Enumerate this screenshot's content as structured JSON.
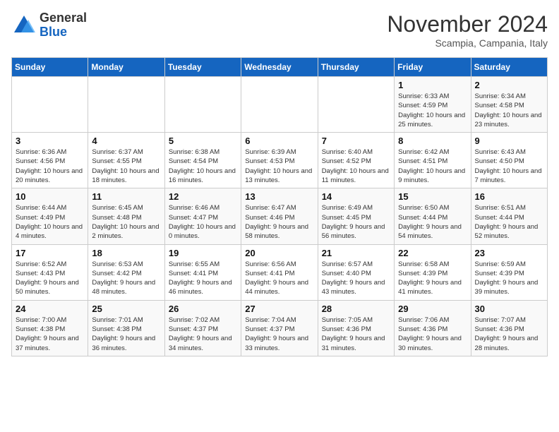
{
  "header": {
    "logo_general": "General",
    "logo_blue": "Blue",
    "month_title": "November 2024",
    "location": "Scampia, Campania, Italy"
  },
  "days_of_week": [
    "Sunday",
    "Monday",
    "Tuesday",
    "Wednesday",
    "Thursday",
    "Friday",
    "Saturday"
  ],
  "weeks": [
    [
      {
        "day": "",
        "info": ""
      },
      {
        "day": "",
        "info": ""
      },
      {
        "day": "",
        "info": ""
      },
      {
        "day": "",
        "info": ""
      },
      {
        "day": "",
        "info": ""
      },
      {
        "day": "1",
        "info": "Sunrise: 6:33 AM\nSunset: 4:59 PM\nDaylight: 10 hours and 25 minutes."
      },
      {
        "day": "2",
        "info": "Sunrise: 6:34 AM\nSunset: 4:58 PM\nDaylight: 10 hours and 23 minutes."
      }
    ],
    [
      {
        "day": "3",
        "info": "Sunrise: 6:36 AM\nSunset: 4:56 PM\nDaylight: 10 hours and 20 minutes."
      },
      {
        "day": "4",
        "info": "Sunrise: 6:37 AM\nSunset: 4:55 PM\nDaylight: 10 hours and 18 minutes."
      },
      {
        "day": "5",
        "info": "Sunrise: 6:38 AM\nSunset: 4:54 PM\nDaylight: 10 hours and 16 minutes."
      },
      {
        "day": "6",
        "info": "Sunrise: 6:39 AM\nSunset: 4:53 PM\nDaylight: 10 hours and 13 minutes."
      },
      {
        "day": "7",
        "info": "Sunrise: 6:40 AM\nSunset: 4:52 PM\nDaylight: 10 hours and 11 minutes."
      },
      {
        "day": "8",
        "info": "Sunrise: 6:42 AM\nSunset: 4:51 PM\nDaylight: 10 hours and 9 minutes."
      },
      {
        "day": "9",
        "info": "Sunrise: 6:43 AM\nSunset: 4:50 PM\nDaylight: 10 hours and 7 minutes."
      }
    ],
    [
      {
        "day": "10",
        "info": "Sunrise: 6:44 AM\nSunset: 4:49 PM\nDaylight: 10 hours and 4 minutes."
      },
      {
        "day": "11",
        "info": "Sunrise: 6:45 AM\nSunset: 4:48 PM\nDaylight: 10 hours and 2 minutes."
      },
      {
        "day": "12",
        "info": "Sunrise: 6:46 AM\nSunset: 4:47 PM\nDaylight: 10 hours and 0 minutes."
      },
      {
        "day": "13",
        "info": "Sunrise: 6:47 AM\nSunset: 4:46 PM\nDaylight: 9 hours and 58 minutes."
      },
      {
        "day": "14",
        "info": "Sunrise: 6:49 AM\nSunset: 4:45 PM\nDaylight: 9 hours and 56 minutes."
      },
      {
        "day": "15",
        "info": "Sunrise: 6:50 AM\nSunset: 4:44 PM\nDaylight: 9 hours and 54 minutes."
      },
      {
        "day": "16",
        "info": "Sunrise: 6:51 AM\nSunset: 4:44 PM\nDaylight: 9 hours and 52 minutes."
      }
    ],
    [
      {
        "day": "17",
        "info": "Sunrise: 6:52 AM\nSunset: 4:43 PM\nDaylight: 9 hours and 50 minutes."
      },
      {
        "day": "18",
        "info": "Sunrise: 6:53 AM\nSunset: 4:42 PM\nDaylight: 9 hours and 48 minutes."
      },
      {
        "day": "19",
        "info": "Sunrise: 6:55 AM\nSunset: 4:41 PM\nDaylight: 9 hours and 46 minutes."
      },
      {
        "day": "20",
        "info": "Sunrise: 6:56 AM\nSunset: 4:41 PM\nDaylight: 9 hours and 44 minutes."
      },
      {
        "day": "21",
        "info": "Sunrise: 6:57 AM\nSunset: 4:40 PM\nDaylight: 9 hours and 43 minutes."
      },
      {
        "day": "22",
        "info": "Sunrise: 6:58 AM\nSunset: 4:39 PM\nDaylight: 9 hours and 41 minutes."
      },
      {
        "day": "23",
        "info": "Sunrise: 6:59 AM\nSunset: 4:39 PM\nDaylight: 9 hours and 39 minutes."
      }
    ],
    [
      {
        "day": "24",
        "info": "Sunrise: 7:00 AM\nSunset: 4:38 PM\nDaylight: 9 hours and 37 minutes."
      },
      {
        "day": "25",
        "info": "Sunrise: 7:01 AM\nSunset: 4:38 PM\nDaylight: 9 hours and 36 minutes."
      },
      {
        "day": "26",
        "info": "Sunrise: 7:02 AM\nSunset: 4:37 PM\nDaylight: 9 hours and 34 minutes."
      },
      {
        "day": "27",
        "info": "Sunrise: 7:04 AM\nSunset: 4:37 PM\nDaylight: 9 hours and 33 minutes."
      },
      {
        "day": "28",
        "info": "Sunrise: 7:05 AM\nSunset: 4:36 PM\nDaylight: 9 hours and 31 minutes."
      },
      {
        "day": "29",
        "info": "Sunrise: 7:06 AM\nSunset: 4:36 PM\nDaylight: 9 hours and 30 minutes."
      },
      {
        "day": "30",
        "info": "Sunrise: 7:07 AM\nSunset: 4:36 PM\nDaylight: 9 hours and 28 minutes."
      }
    ]
  ]
}
